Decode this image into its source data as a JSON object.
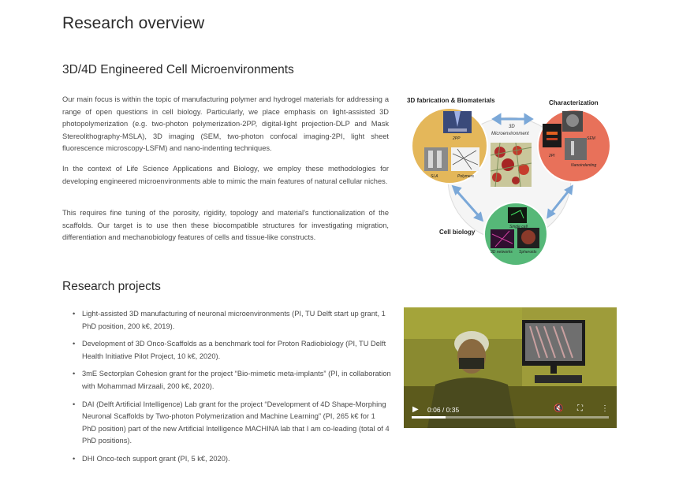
{
  "page_title": "Research overview",
  "section1": {
    "title": "3D/4D Engineered Cell Microenvironments",
    "paragraphs": [
      "Our main focus is within the topic of manufacturing polymer and hydrogel materials for addressing a range of open questions in cell biology. Particularly, we place emphasis on light-assisted 3D photopolymerization (e.g. two-photon polymerization-2PP, digital-light projection-DLP and Mask Stereolithography-MSLA), 3D imaging (SEM, two-photon confocal imaging-2PI, light sheet fluorescence microscopy-LSFM) and nano-indenting techniques.",
      "In the context of Life Science Applications and Biology, we employ these methodologies for developing engineered microenvironments able to mimic the main features of natural cellular niches.",
      "This requires fine tuning of the porosity, rigidity, topology and material's functionalization of the scaffolds. Our target is to use then these biocompatible structures for investigating migration, differentiation and mechanobiology features of cells and tissue-like constructs."
    ]
  },
  "figure": {
    "fab_title": "3D fabrication & Biomaterials",
    "char_title": "Characterization",
    "bio_title": "Cell biology",
    "center_label_1": "3D",
    "center_label_2": "Microenvironment",
    "label_2pp": "2PP",
    "label_sla": "SLA",
    "label_polymers": "Polymers",
    "label_sem": "SEM",
    "label_2pi": "2PI",
    "label_nano": "Nanoindenting",
    "label_single": "Single cell",
    "label_networks": "3D networks",
    "label_spheroids": "Spheroids",
    "colors": {
      "fab": "#e4b75a",
      "char": "#e8715a",
      "bio": "#56b878",
      "arrow": "#7ba8d8"
    }
  },
  "section2": {
    "title": "Research projects",
    "projects": [
      "Light-assisted 3D manufacturing of neuronal microenvironments (PI, TU Delft start up grant, 1 PhD position, 200 k€, 2019).",
      "Development of 3D Onco-Scaffolds as a benchmark tool for Proton Radiobiology (PI, TU Delft Health Initiative Pilot Project, 10 k€, 2020).",
      "3mE Sectorplan Cohesion grant for the project “Bio-mimetic meta-implants” (PI, in collaboration with Mohammad Mirzaali, 200 k€, 2020).",
      "DAI (Delft Artificial Intelligence) Lab grant for the project “Development of 4D Shape-Morphing Neuronal Scaffolds by Two-photon Polymerization and Machine Learning” (PI, 265 k€ for 1 PhD position) part of the new Artificial Intelligence MACHINA lab that I am co-leading (total of 4 PhD positions).",
      "DHI Onco-tech support grant (PI, 5 k€, 2020)."
    ],
    "bullet": "•"
  },
  "video": {
    "time": "0:06 / 0:35",
    "progress": 0.17,
    "play_icon": "play-icon",
    "icons": [
      "mute-icon",
      "fullscreen-icon",
      "more-icon"
    ]
  }
}
